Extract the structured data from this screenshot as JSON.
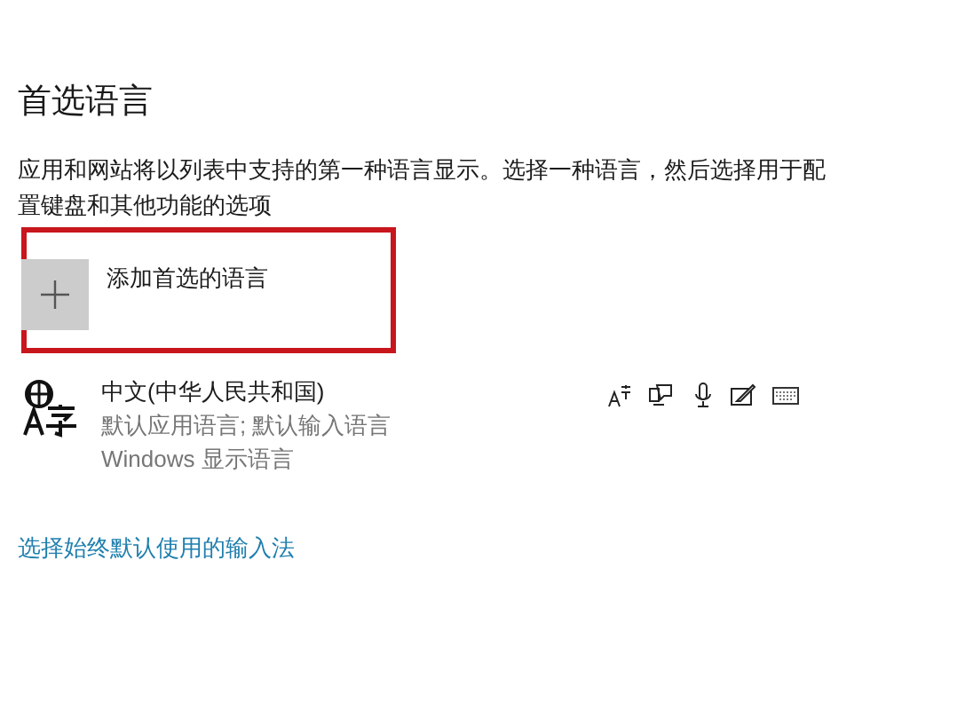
{
  "title": "首选语言",
  "description": "应用和网站将以列表中支持的第一种语言显示。选择一种语言，然后选择用于配置键盘和其他功能的选项",
  "add_language": {
    "label": "添加首选的语言"
  },
  "languages": [
    {
      "name": "中文(中华人民共和国)",
      "details": [
        "默认应用语言; 默认输入语言",
        "Windows 显示语言"
      ]
    }
  ],
  "link": "选择始终默认使用的输入法"
}
